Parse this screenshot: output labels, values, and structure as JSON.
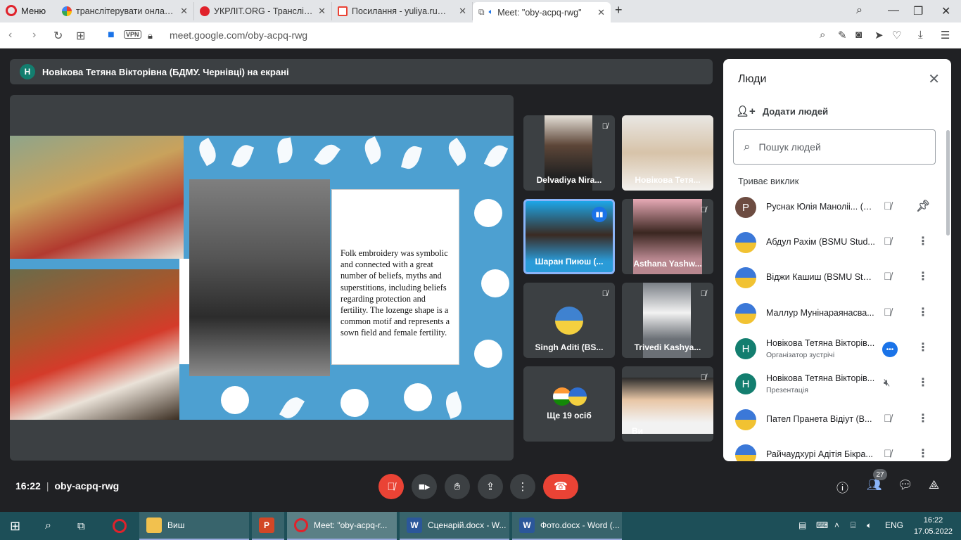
{
  "browser": {
    "menu_label": "Меню",
    "tabs": [
      {
        "label": "транслітерувати онлайн -",
        "color": "#4285f4"
      },
      {
        "label": "УКРЛІТ.ORG - Транслітера",
        "color": "#e0222b"
      },
      {
        "label": "Посилання - yuliya.ru@gm",
        "color": "#ea4335"
      },
      {
        "label": "Meet: \"oby-acpq-rwg\"",
        "color": "#1e8e3e"
      }
    ],
    "new_tab": "+",
    "close_tab": "✕",
    "url": "meet.google.com/oby-acpq-rwg",
    "vpn_label": "VPN"
  },
  "meet": {
    "presenter_avatar": "Н",
    "presenter_text": "Новікова Тетяна Вікторівна (БДМУ. Чернівці) на екрані",
    "slide_text": "Folk embroidery was symbolic and connected with a great number of beliefs, myths and superstitions, including beliefs regarding protection and fertility. The lozenge shape is a common motif and represents a sown field and female fertility.",
    "tiles": [
      {
        "name": "Delvadiya Nira..."
      },
      {
        "name": "Новікова Тетя..."
      },
      {
        "name": "Шаран Пиюш (..."
      },
      {
        "name": "Asthana Yashw..."
      },
      {
        "name": "Singh Aditi (BS..."
      },
      {
        "name": "Trivedi Kashya..."
      },
      {
        "name": "Ще 19 осіб"
      },
      {
        "name": "Ви"
      }
    ],
    "meeting_time": "16:22",
    "meeting_code": "oby-acpq-rwg",
    "participants_count": "27"
  },
  "people_panel": {
    "title": "Люди",
    "add_people": "Додати людей",
    "search_placeholder": "Пошук людей",
    "section_title": "Триває виклик",
    "people": [
      {
        "name": "Руснак Юлія Маноліі... (Ви)",
        "sub": "",
        "avatar": "Р"
      },
      {
        "name": "Абдул Рахім (BSMU Stud...",
        "sub": "",
        "avatar": ""
      },
      {
        "name": "Віджи Кашиш (BSMU Stude...",
        "sub": "",
        "avatar": ""
      },
      {
        "name": "Маллур Мунінараянасва...",
        "sub": "",
        "avatar": ""
      },
      {
        "name": "Новікова Тетяна Вікторів...",
        "sub": "Організатор зустрічі",
        "avatar": "Н"
      },
      {
        "name": "Новікова Тетяна Вікторів...",
        "sub": "Презентація",
        "avatar": "Н"
      },
      {
        "name": "Пател Пранета Відіут (В...",
        "sub": "",
        "avatar": ""
      },
      {
        "name": "Райчаудхурі Адітія Бікра...",
        "sub": "",
        "avatar": ""
      }
    ]
  },
  "taskbar": {
    "apps": [
      {
        "label": "Виш"
      },
      {
        "label": ""
      },
      {
        "label": "Meet: \"oby-acpq-r..."
      },
      {
        "label": "Сценарій.docx - W..."
      },
      {
        "label": "Фото.docx - Word (..."
      }
    ],
    "lang": "ENG",
    "time": "16:22",
    "date": "17.05.2022"
  }
}
